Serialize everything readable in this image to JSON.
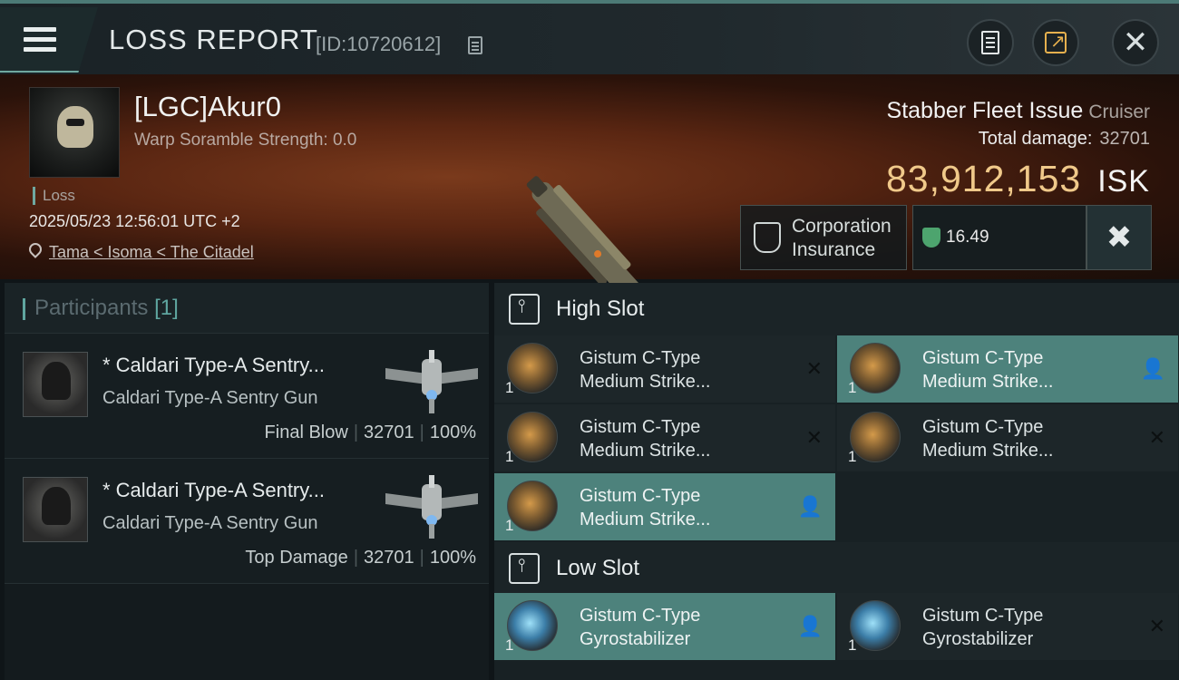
{
  "header": {
    "title": "LOSS REPORT",
    "report_id": "[ID:10720612]"
  },
  "victim": {
    "name": "[LGC]Akur0",
    "warp_scramble": "Warp Soramble Strength: 0.0",
    "status": "Loss",
    "datetime": "2025/05/23 12:56:01 UTC +2",
    "location": "Tama < Isoma < The Citadel"
  },
  "ship": {
    "name": "Stabber Fleet Issue",
    "class": "Cruiser",
    "total_damage_label": "Total damage:",
    "total_damage": "32701",
    "value": "83,912,153",
    "value_unit": "ISK",
    "insurance_line1": "Corporation",
    "insurance_line2": "Insurance",
    "security": "16.49"
  },
  "participants": {
    "label": "Participants",
    "count": "[1]",
    "rows": [
      {
        "name": "* Caldari Type-A Sentry...",
        "type": "Caldari Type-A Sentry Gun",
        "role": "Final Blow",
        "damage": "32701",
        "percent": "100%"
      },
      {
        "name": "* Caldari Type-A Sentry...",
        "type": "Caldari Type-A Sentry Gun",
        "role": "Top Damage",
        "damage": "32701",
        "percent": "100%"
      }
    ]
  },
  "slots": {
    "high_label": "High Slot",
    "low_label": "Low Slot",
    "high": [
      {
        "line1": "Gistum C-Type",
        "line2": "Medium Strike...",
        "qty": "1",
        "state": "destroyed"
      },
      {
        "line1": "Gistum C-Type",
        "line2": "Medium Strike...",
        "qty": "1",
        "state": "dropped"
      },
      {
        "line1": "Gistum C-Type",
        "line2": "Medium Strike...",
        "qty": "1",
        "state": "destroyed"
      },
      {
        "line1": "Gistum C-Type",
        "line2": "Medium Strike...",
        "qty": "1",
        "state": "destroyed"
      },
      {
        "line1": "Gistum C-Type",
        "line2": "Medium Strike...",
        "qty": "1",
        "state": "dropped"
      }
    ],
    "low": [
      {
        "line1": "Gistum C-Type",
        "line2": "Gyrostabilizer",
        "qty": "1",
        "state": "dropped"
      },
      {
        "line1": "Gistum C-Type",
        "line2": "Gyrostabilizer",
        "qty": "1",
        "state": "destroyed"
      }
    ]
  },
  "colors": {
    "accent": "#4d827c",
    "isk_gold": "#f0c98a",
    "security_green": "#4da46e"
  }
}
